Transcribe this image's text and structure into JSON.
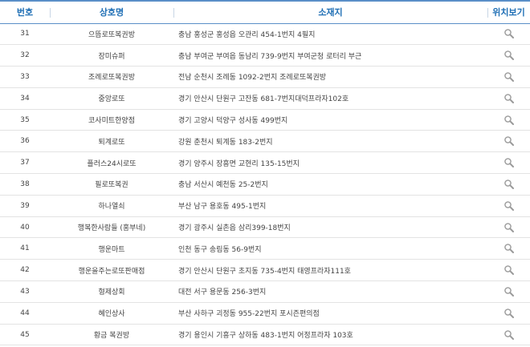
{
  "table": {
    "headers": {
      "no": "번호",
      "name": "상호명",
      "address": "소재지",
      "location": "위치보기"
    },
    "view_icon": "magnifier-icon",
    "icon_color": "#9a9a9a",
    "header_color": "#1f6fb5",
    "rows": [
      {
        "no": "31",
        "name": "으뜸로또복권방",
        "address": "충남 홍성군 홍성읍 오관리 454-1번지 4필지"
      },
      {
        "no": "32",
        "name": "장미슈퍼",
        "address": "충남 부여군 부여읍 동남리 739-9번지 부여군청 로터리 부근"
      },
      {
        "no": "33",
        "name": "조례로또복권방",
        "address": "전남 순천시 조례동 1092-2번지 조례로또복권방"
      },
      {
        "no": "34",
        "name": "중앙로또",
        "address": "경기 안산시 단원구 고잔동 681-7번지대덕프라자102호"
      },
      {
        "no": "35",
        "name": "코사미트한양점",
        "address": "경기 고양시 덕양구 성사동 499번지"
      },
      {
        "no": "36",
        "name": "퇴계로또",
        "address": "강원 춘천시 퇴계동 183-2번지"
      },
      {
        "no": "37",
        "name": "플러스24시로또",
        "address": "경기 양주시 장흥면 교현리 135-15번지"
      },
      {
        "no": "38",
        "name": "필로또복권",
        "address": "충남 서산시 예천동 25-2번지"
      },
      {
        "no": "39",
        "name": "하나열쇠",
        "address": "부산 남구 용호동 495-1번지"
      },
      {
        "no": "40",
        "name": "행복한사람들 (홍부네)",
        "address": "경기 광주시 실촌읍 삼리399-18번지"
      },
      {
        "no": "41",
        "name": "행운마트",
        "address": "인천 동구 송림동 56-9번지"
      },
      {
        "no": "42",
        "name": "행운을주는로또판매점",
        "address": "경기 안산시 단원구 초지동 735-4번지 태영프라자111호"
      },
      {
        "no": "43",
        "name": "형제상회",
        "address": "대전 서구 용문동 256-3번지"
      },
      {
        "no": "44",
        "name": "혜인상사",
        "address": "부산 사하구 괴정동 955-22번지 포시즌편의점"
      },
      {
        "no": "45",
        "name": "황금 복권방",
        "address": "경기 용인시 기흥구 상하동 483-1번지 어정프라자 103호"
      }
    ]
  }
}
